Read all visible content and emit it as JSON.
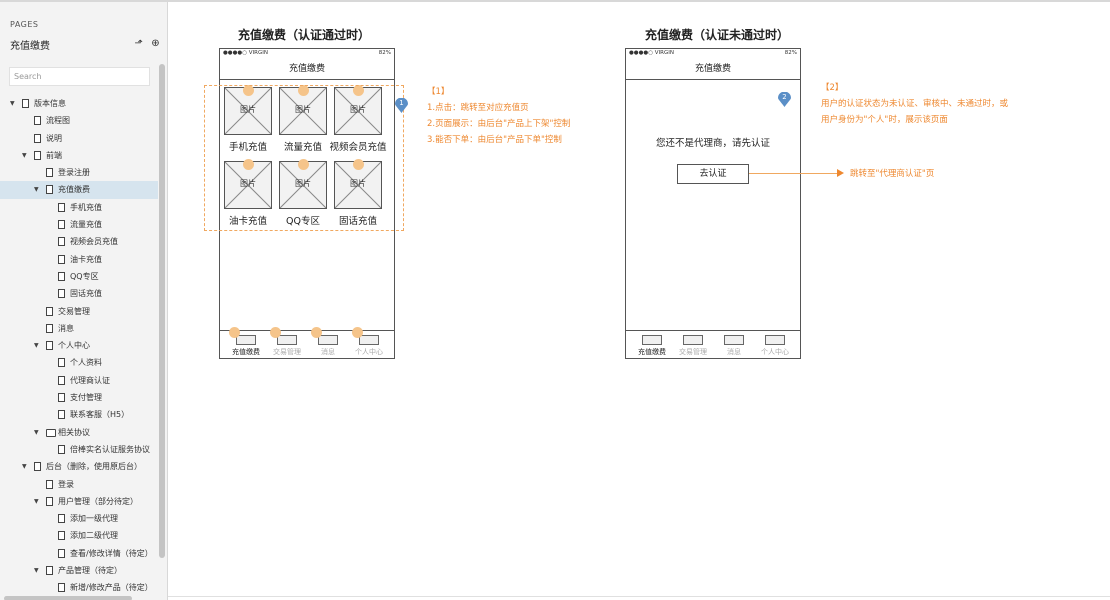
{
  "sidebar": {
    "section_label": "PAGES",
    "page_title": "充值缴费",
    "search_placeholder": "Search",
    "tree": [
      {
        "label": "版本信息",
        "level": 0,
        "expanded": true,
        "type": "page"
      },
      {
        "label": "流程图",
        "level": 1,
        "type": "page"
      },
      {
        "label": "说明",
        "level": 1,
        "type": "page"
      },
      {
        "label": "前端",
        "level": 1,
        "expanded": true,
        "type": "page"
      },
      {
        "label": "登录注册",
        "level": 2,
        "type": "page"
      },
      {
        "label": "充值缴费",
        "level": 2,
        "expanded": true,
        "type": "page",
        "selected": true
      },
      {
        "label": "手机充值",
        "level": 3,
        "type": "page"
      },
      {
        "label": "流量充值",
        "level": 3,
        "type": "page"
      },
      {
        "label": "视频会员充值",
        "level": 3,
        "type": "page"
      },
      {
        "label": "油卡充值",
        "level": 3,
        "type": "page"
      },
      {
        "label": "QQ专区",
        "level": 3,
        "type": "page"
      },
      {
        "label": "固话充值",
        "level": 3,
        "type": "page"
      },
      {
        "label": "交易管理",
        "level": 2,
        "type": "page"
      },
      {
        "label": "消息",
        "level": 2,
        "type": "page"
      },
      {
        "label": "个人中心",
        "level": 2,
        "expanded": true,
        "type": "page"
      },
      {
        "label": "个人资料",
        "level": 3,
        "type": "page"
      },
      {
        "label": "代理商认证",
        "level": 3,
        "type": "page"
      },
      {
        "label": "支付管理",
        "level": 3,
        "type": "page"
      },
      {
        "label": "联系客服（H5）",
        "level": 3,
        "type": "page"
      },
      {
        "label": "相关协议",
        "level": 2,
        "expanded": true,
        "type": "folder"
      },
      {
        "label": "倍棒实名认证服务协议",
        "level": 3,
        "type": "page"
      },
      {
        "label": "后台（删除，使用原后台）",
        "level": 1,
        "expanded": true,
        "type": "page"
      },
      {
        "label": "登录",
        "level": 2,
        "type": "page"
      },
      {
        "label": "用户管理（部分待定）",
        "level": 2,
        "expanded": true,
        "type": "page"
      },
      {
        "label": "添加一级代理",
        "level": 3,
        "type": "page"
      },
      {
        "label": "添加二级代理",
        "level": 3,
        "type": "page"
      },
      {
        "label": "查看/修改详情（待定）",
        "level": 3,
        "type": "page"
      },
      {
        "label": "产品管理（待定）",
        "level": 2,
        "expanded": true,
        "type": "page"
      },
      {
        "label": "新增/修改产品（待定）",
        "level": 3,
        "type": "page"
      }
    ]
  },
  "phone1": {
    "heading": "充值缴费（认证通过时）",
    "carrier": "●●●●○ VIRGIN",
    "battery": "82%",
    "nav_title": "充值缴费",
    "image_placeholder": "图片",
    "items": [
      "手机充值",
      "流量充值",
      "视频会员充值",
      "油卡充值",
      "QQ专区",
      "固话充值"
    ],
    "tabs": [
      "充值缴费",
      "交易管理",
      "消息",
      "个人中心"
    ],
    "pin_label": "1"
  },
  "note1": {
    "title": "【1】",
    "lines": [
      "1.点击：跳转至对应充值页",
      "2.页面展示：由后台\"产品上下架\"控制",
      "3.能否下单：由后台\"产品下单\"控制"
    ]
  },
  "phone2": {
    "heading": "充值缴费（认证未通过时）",
    "carrier": "●●●●○ VIRGIN",
    "battery": "82%",
    "nav_title": "充值缴费",
    "message": "您还不是代理商，请先认证",
    "button": "去认证",
    "tabs": [
      "充值缴费",
      "交易管理",
      "消息",
      "个人中心"
    ],
    "pin_label": "2"
  },
  "note2": {
    "title": "【2】",
    "lines": [
      "用户的认证状态为未认证、审核中、未通过时，或",
      "用户身份为\"个人\"时，展示该页面"
    ]
  },
  "arrow_note": "跳转至\"代理商认证\"页",
  "colors": {
    "annotation": "#ee8830",
    "pin": "#5b8fc7",
    "selected_row": "#d6e4ee"
  }
}
